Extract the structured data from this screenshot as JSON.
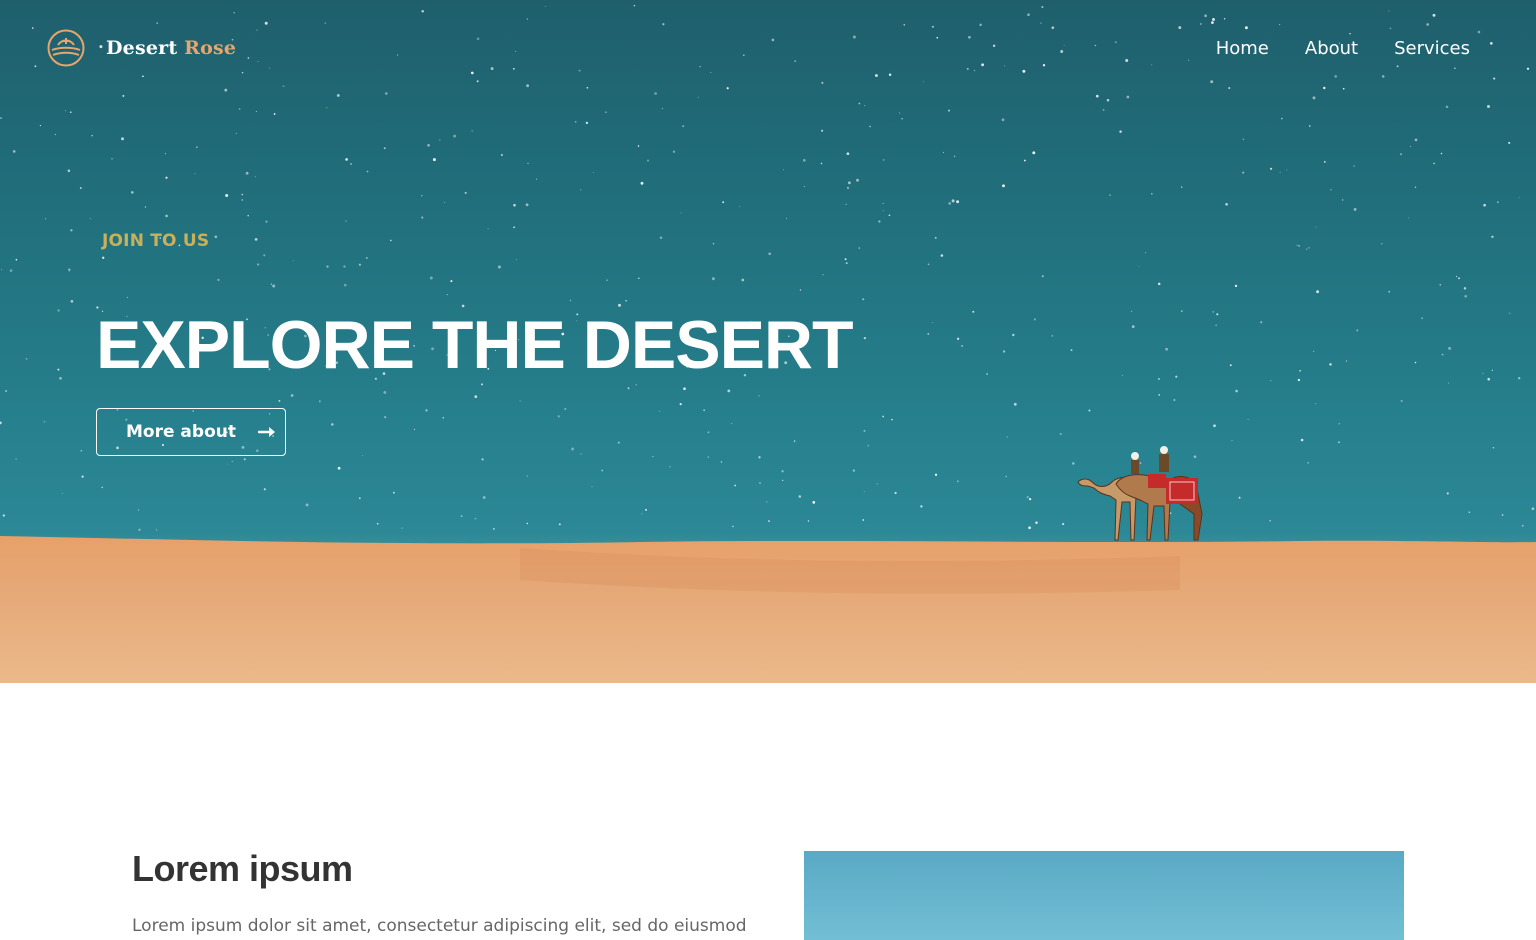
{
  "brand": {
    "name_part1": "Desert ",
    "name_part2": "Rose"
  },
  "nav": {
    "items": [
      "Home",
      "About",
      "Services"
    ]
  },
  "hero": {
    "eyebrow": "JOIN TO US",
    "title": "EXPLORE THE DESERT",
    "cta_label": "More about"
  },
  "section": {
    "title": "Lorem ipsum",
    "text": "Lorem ipsum dolor sit amet, consectetur adipiscing elit, sed do eiusmod"
  },
  "colors": {
    "sky": "#216f7c",
    "sand": "#e5a877",
    "accent_brand": "#e8a56c",
    "eyebrow": "#c9b15a",
    "section_title": "#333333",
    "section_text": "#666666"
  },
  "icons": {
    "logo": "sun-over-dunes-icon",
    "cta": "arrow-right-icon"
  }
}
